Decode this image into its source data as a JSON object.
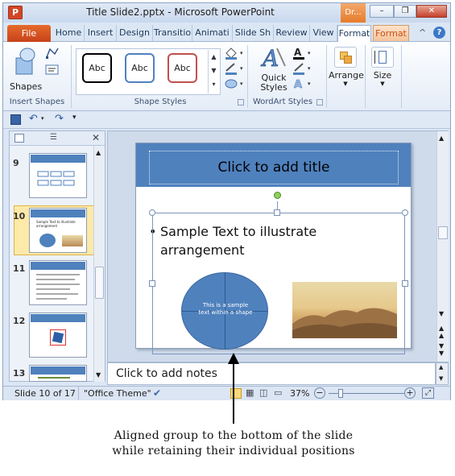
{
  "window": {
    "app_icon": "P",
    "title": "Title Slide2.pptx - Microsoft PowerPoint",
    "context_tab": "Dr...",
    "minimize": "–",
    "restore": "❐",
    "close": "✕"
  },
  "tabs": {
    "file": "File",
    "items": [
      "Home",
      "Insert",
      "Design",
      "Transitio",
      "Animati",
      "Slide Sh",
      "Review",
      "View",
      "Format",
      "Format"
    ],
    "help": "?"
  },
  "ribbon": {
    "insert_shapes": {
      "shapes_label": "Shapes",
      "group_label": "Insert Shapes"
    },
    "shape_styles": {
      "styles": [
        "Abc",
        "Abc",
        "Abc"
      ],
      "group_label": "Shape Styles",
      "style_colors": [
        "#000000",
        "#4f81bd",
        "#c0504d"
      ]
    },
    "wordart": {
      "quick_styles": "Quick Styles",
      "group_label": "WordArt Styles"
    },
    "arrange": {
      "label": "Arrange"
    },
    "size": {
      "label": "Size"
    }
  },
  "slides_pane": {
    "thumbs": [
      {
        "num": "9"
      },
      {
        "num": "10",
        "text": "Sample Text to illustrate arrangement"
      },
      {
        "num": "11"
      },
      {
        "num": "12"
      },
      {
        "num": "13"
      }
    ]
  },
  "slide": {
    "title_placeholder": "Click to add title",
    "bullet": "Sample Text to illustrate arrangement",
    "ellipse_text": "This is a sample text within a shape"
  },
  "notes": {
    "placeholder": "Click to add notes"
  },
  "status": {
    "slide_counter": "Slide 10 of 17",
    "theme": "\"Office Theme\"",
    "zoom": "37%"
  },
  "caption": {
    "line1": "Aligned group to the bottom of the slide",
    "line2": "while retaining their individual positions"
  },
  "colors": {
    "accent": "#4f81bd",
    "file_tab": "#d24726",
    "context": "#e77b2a"
  }
}
